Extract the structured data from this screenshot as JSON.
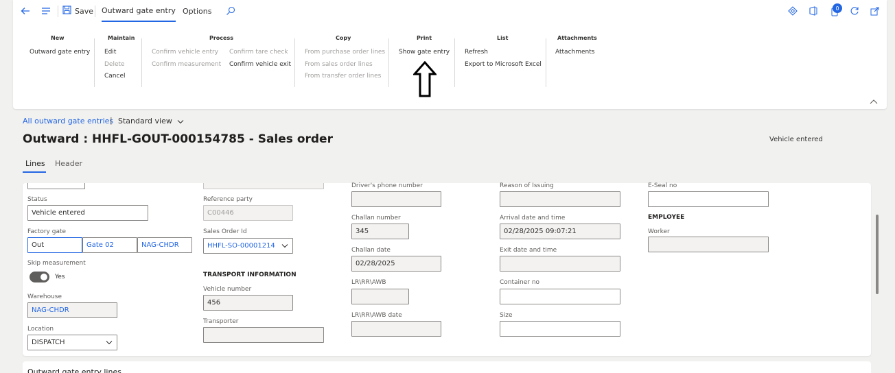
{
  "toolbar": {
    "save_label": "Save",
    "tabs": [
      "Outward gate entry",
      "Options"
    ],
    "badge_count": "0"
  },
  "ribbon": {
    "groups": {
      "new": {
        "title": "New",
        "items": [
          "Outward gate entry"
        ]
      },
      "maintain": {
        "title": "Maintain",
        "items": [
          "Edit",
          "Delete",
          "Cancel"
        ]
      },
      "process": {
        "title": "Process",
        "items": [
          "Confirm vehicle entry",
          "Confirm tare check",
          "Confirm measurement",
          "Confirm vehicle exit"
        ]
      },
      "copy": {
        "title": "Copy",
        "items": [
          "From purchase order lines",
          "From sales order lines",
          "From transfer order lines"
        ]
      },
      "print": {
        "title": "Print",
        "items": [
          "Show gate entry"
        ]
      },
      "list": {
        "title": "List",
        "items": [
          "Refresh",
          "Export to Microsoft Excel"
        ]
      },
      "attachments": {
        "title": "Attachments",
        "items": [
          "Attachments"
        ]
      }
    }
  },
  "header": {
    "breadcrumb": "All outward gate entries",
    "separator": "|",
    "view": "Standard view",
    "title": "Outward : HHFL-GOUT-000154785 - Sales order",
    "status": "Vehicle entered",
    "subtabs": [
      "Lines",
      "Header"
    ]
  },
  "form": {
    "col1": {
      "status_label": "Status",
      "status_value": "Vehicle entered",
      "factory_gate_label": "Factory gate",
      "factory_gate_values": [
        "Out",
        "Gate 02",
        "NAG-CHDR"
      ],
      "skip_label": "Skip measurement",
      "skip_value": "Yes",
      "warehouse_label": "Warehouse",
      "warehouse_value": "NAG-CHDR",
      "location_label": "Location",
      "location_value": "DISPATCH"
    },
    "col2": {
      "reference_party_label": "Reference party",
      "reference_party_value": "C00446",
      "sales_order_label": "Sales Order Id",
      "sales_order_value": "HHFL-SO-00001214",
      "transport_heading": "TRANSPORT INFORMATION",
      "vehicle_label": "Vehicle number",
      "vehicle_value": "456",
      "transporter_label": "Transporter",
      "transporter_value": ""
    },
    "col3": {
      "driver_phone_label": "Driver's phone number",
      "driver_phone_value": "",
      "challan_number_label": "Challan number",
      "challan_number_value": "345",
      "challan_date_label": "Challan date",
      "challan_date_value": "02/28/2025",
      "lr_label": "LR\\RR\\AWB",
      "lr_value": "",
      "lr_date_label": "LR\\RR\\AWB date",
      "lr_date_value": ""
    },
    "col4": {
      "reason_label": "Reason of Issuing",
      "reason_value": "",
      "arrival_label": "Arrival date and time",
      "arrival_value": "02/28/2025 09:07:21",
      "exit_label": "Exit date and time",
      "exit_value": "",
      "container_label": "Container no",
      "container_value": "",
      "size_label": "Size",
      "size_value": ""
    },
    "col5": {
      "eseal_label": "E-Seal no",
      "eseal_value": "",
      "employee_heading": "EMPLOYEE",
      "worker_label": "Worker",
      "worker_value": ""
    }
  },
  "lines_section": {
    "title": "Outward gate entry lines"
  }
}
